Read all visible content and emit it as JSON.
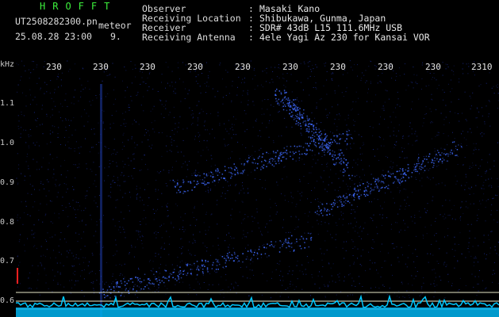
{
  "header": {
    "logo_text": "HROFFT",
    "filename": "UT2508282300.pn",
    "mode": "meteor",
    "datetime": "25.08.28 23:00",
    "count": "9.",
    "info": [
      {
        "key": "Observer",
        "sep": ":",
        "value": "Masaki Kano"
      },
      {
        "key": "Receiving Location",
        "sep": ":",
        "value": "Shibukawa, Gunma, Japan"
      },
      {
        "key": "Receiver",
        "sep": ":",
        "value": "SDR# 43dB L15 111.6MHz USB"
      },
      {
        "key": "Receiving Antenna",
        "sep": ":",
        "value": "4ele Yagi Az 230 for Kansai VOR"
      }
    ]
  },
  "axes": {
    "y_unit": "kHz",
    "y_ticks": [
      "1.1",
      "1.0",
      "0.9",
      "0.8",
      "0.7",
      "0.6"
    ],
    "x_ticks": [
      "230",
      "230",
      "230",
      "230",
      "230",
      "230",
      "230",
      "230",
      "230",
      "230",
      "2310"
    ]
  },
  "colors": {
    "background": "#000000",
    "noise": "#1a2a8c",
    "signal": "#3f6aff",
    "hline": "#e8e8c8",
    "baseline": "#00c8ff",
    "logo": "#3cf03c",
    "marker": "#ff2020"
  }
}
